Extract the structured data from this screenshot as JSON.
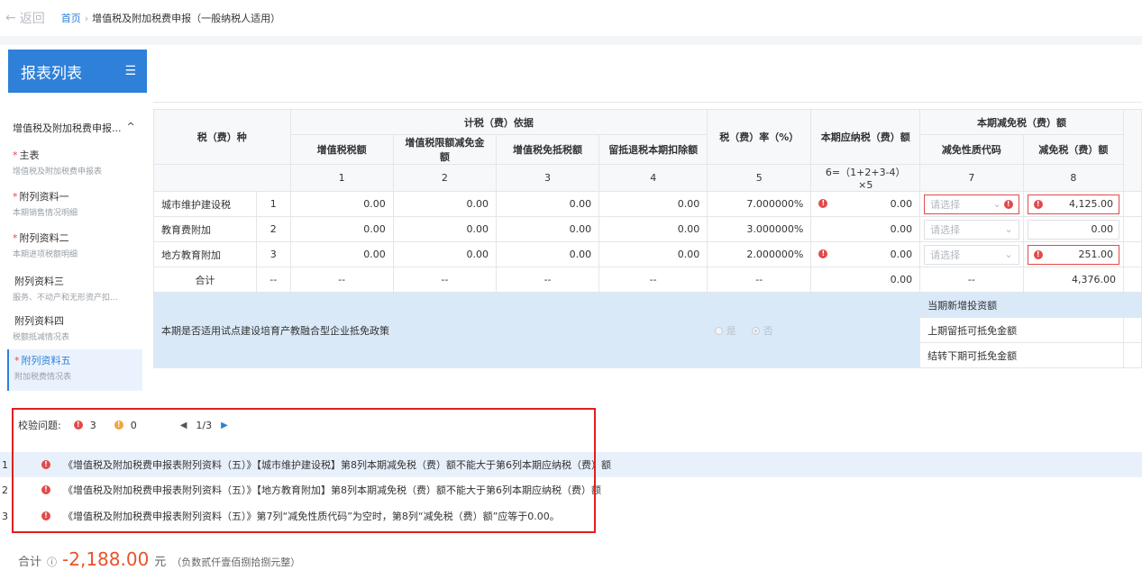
{
  "topbar": {
    "back_label": "返回",
    "home_label": "首页",
    "current_page": "增值税及附加税费申报（一般纳税人适用）"
  },
  "sidebar": {
    "title": "报表列表",
    "group_label": "增值税及附加税费申报...",
    "items": [
      {
        "title": "主表",
        "sub": "增值税及附加税费申报表",
        "required": "*"
      },
      {
        "title": "附列资料一",
        "sub": "本期销售情况明细",
        "required": "*"
      },
      {
        "title": "附列资料二",
        "sub": "本期进项税额明细",
        "required": "*"
      },
      {
        "title": "附列资料三",
        "sub": "服务、不动产和无形资产扣...",
        "required": ""
      },
      {
        "title": "附列资料四",
        "sub": "税额抵减情况表",
        "required": ""
      },
      {
        "title": "附列资料五",
        "sub": "附加税费情况表",
        "required": "*"
      }
    ]
  },
  "table": {
    "head": {
      "tax_type": "税（费）种",
      "basis_group": "计税（费）依据",
      "col_vat": "增值税税额",
      "col_limit": "增值税限额减免金额",
      "col_exempt": "增值税免抵税额",
      "col_refund": "留抵退税本期扣除额",
      "col_rate": "税（费）率（%）",
      "col_payable": "本期应纳税（费）额",
      "relief_group": "本期减免税（费）额",
      "col_relief_code": "减免性质代码",
      "col_relief_amt": "减免税（费）额"
    },
    "index_row": [
      "1",
      "2",
      "3",
      "4",
      "5",
      "6=（1+2+3-4）×5",
      "7",
      "8"
    ],
    "rows": [
      {
        "name": "城市维护建设税",
        "no": "1",
        "vat": "0.00",
        "limit": "0.00",
        "exempt": "0.00",
        "refund": "0.00",
        "rate": "7.000000%",
        "payable": "0.00",
        "code_placeholder": "请选择",
        "relief": "4,125.00"
      },
      {
        "name": "教育费附加",
        "no": "2",
        "vat": "0.00",
        "limit": "0.00",
        "exempt": "0.00",
        "refund": "0.00",
        "rate": "3.000000%",
        "payable": "0.00",
        "code_placeholder": "请选择",
        "relief": "0.00"
      },
      {
        "name": "地方教育附加",
        "no": "3",
        "vat": "0.00",
        "limit": "0.00",
        "exempt": "0.00",
        "refund": "0.00",
        "rate": "2.000000%",
        "payable": "0.00",
        "code_placeholder": "请选择",
        "relief": "251.00"
      }
    ],
    "total_row": {
      "name": "合计",
      "no": "--",
      "vat": "--",
      "limit": "--",
      "exempt": "--",
      "refund": "--",
      "rate": "--",
      "payable": "0.00",
      "code": "--",
      "relief": "4,376.00"
    },
    "policy": {
      "question": "本期是否适用试点建设培育产教融合型企业抵免政策",
      "yes": "是",
      "no": "否",
      "selected": "否",
      "labels": [
        "当期新增投资额",
        "上期留抵可抵免金额",
        "结转下期可抵免金额"
      ]
    }
  },
  "validation": {
    "label": "校验问题:",
    "error_count": "3",
    "warning_count": "0",
    "page": "1/3",
    "items": [
      {
        "no": "1",
        "message": "《增值税及附加税费申报表附列资料（五）》【城市维护建设税】第8列本期减免税（费）额不能大于第6列本期应纳税（费）额"
      },
      {
        "no": "2",
        "message": "《增值税及附加税费申报表附列资料（五）》【地方教育附加】第8列本期减免税（费）额不能大于第6列本期应纳税（费）额"
      },
      {
        "no": "3",
        "message": "《增值税及附加税费申报表附列资料（五）》第7列“减免性质代码”为空时，第8列“减免税（费）额”应等于0.00。"
      }
    ]
  },
  "total": {
    "label": "合计",
    "amount": "-2,188.00",
    "unit": "元",
    "words": "（负数贰仟壹佰捌拾捌元整）"
  },
  "colors": {
    "accent": "#2f80d8",
    "error": "#e24a4a",
    "warning": "#f0a53b",
    "highlight": "#e02020"
  }
}
